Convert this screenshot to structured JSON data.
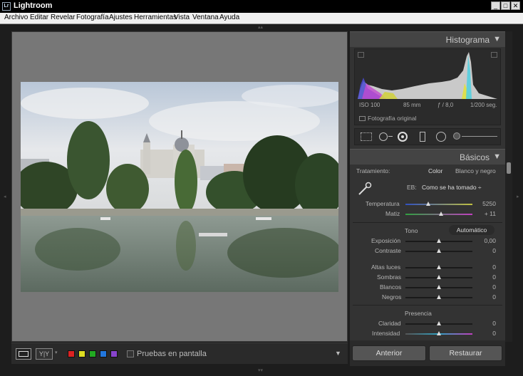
{
  "window": {
    "title": "Lightroom",
    "icon_text": "Lr"
  },
  "window_controls": {
    "minimize": "_",
    "maximize": "□",
    "close": "✕"
  },
  "menu": [
    "Archivo",
    "Editar",
    "Revelar",
    "Fotografía",
    "Ajustes",
    "Herramientas",
    "Vista",
    "Ventana",
    "Ayuda"
  ],
  "toolbar": {
    "view_compare_label": "Y|Y",
    "swatches": [
      "#dd2222",
      "#dddd22",
      "#22aa22",
      "#2277dd",
      "#8844cc"
    ],
    "soft_proof_label": "Pruebas en pantalla",
    "menu_arrow": "▼"
  },
  "histogram": {
    "title": "Histograma",
    "collapse_icon": "▼",
    "iso": "ISO 100",
    "focal": "85 mm",
    "aperture": "ƒ / 8,0",
    "shutter": "1/200 seg.",
    "original_label": "Fotografía original"
  },
  "basic": {
    "title": "Básicos",
    "collapse_icon": "▼",
    "treatment_label": "Tratamiento:",
    "color_label": "Color",
    "bw_label": "Blanco y negro",
    "wb_label": "EB:",
    "wb_value": "Como se ha tomado ÷",
    "temp_label": "Temperatura",
    "temp_value": "5250",
    "tint_label": "Matiz",
    "tint_value": "+ 11",
    "tone_label": "Tono",
    "auto_label": "Automático",
    "exposure_label": "Exposición",
    "exposure_value": "0,00",
    "contrast_label": "Contraste",
    "contrast_value": "0",
    "highlights_label": "Altas luces",
    "highlights_value": "0",
    "shadows_label": "Sombras",
    "shadows_value": "0",
    "whites_label": "Blancos",
    "whites_value": "0",
    "blacks_label": "Negros",
    "blacks_value": "0",
    "presence_label": "Presencia",
    "clarity_label": "Claridad",
    "clarity_value": "0",
    "vibrance_label": "Intensidad",
    "vibrance_value": "0"
  },
  "footer": {
    "previous_label": "Anterior",
    "reset_label": "Restaurar"
  }
}
